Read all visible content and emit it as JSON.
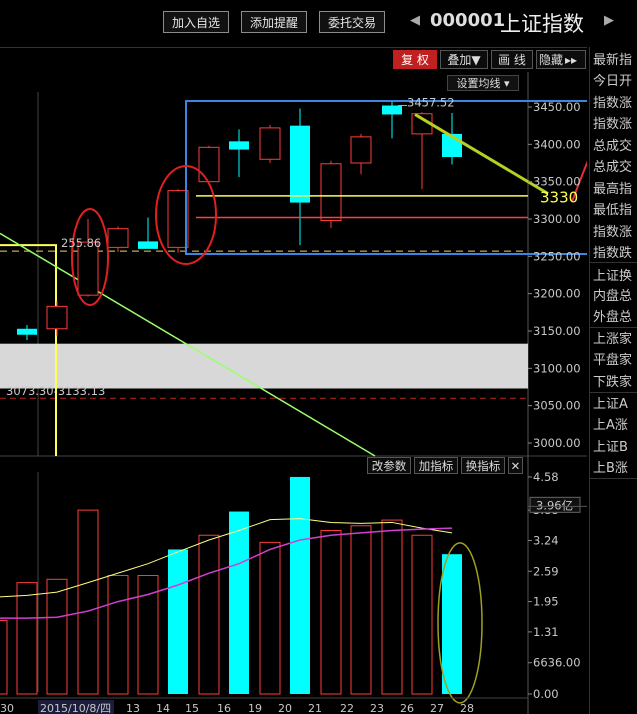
{
  "toolbar": {
    "add_watchlist": "加入自选",
    "add_alert": "添加提醒",
    "entrust_trade": "委托交易",
    "prev_arrow": "◀",
    "next_arrow": "▶",
    "stock_code": "000001",
    "stock_name": "上证指数"
  },
  "chart_toolbar": {
    "fuquan": "复 权",
    "overlay": "叠加▼",
    "draw": "画 线",
    "hide": "隐藏",
    "hide_arrows": "▸▸",
    "set_ma": "设置均线 ▾"
  },
  "right_panel": [
    "最新指",
    "今日开",
    "指数涨",
    "指数涨",
    "总成交",
    "总成交",
    "最高指",
    "最低指",
    "指数涨",
    "指数跌",
    "上证换",
    "内盘总",
    "外盘总",
    "上涨家",
    "平盘家",
    "下跌家",
    "上证A",
    "上A涨",
    "上证B",
    "上B涨"
  ],
  "price_axis": [
    "3450.00",
    "3400.00",
    "3350.00",
    "3300.00",
    "3250.00",
    "3200.00",
    "3150.00",
    "3100.00",
    "3050.00",
    "3000.00"
  ],
  "volume_axis": [
    "4.58",
    "3.88",
    "3.24",
    "2.59",
    "1.95",
    "1.31",
    "6636.00",
    "0.00"
  ],
  "volume_badge": "3.96亿",
  "annotations": {
    "high_label": "3457.52",
    "left_label": "255.86",
    "range_label": "3073.30-3133.13",
    "target_label": "3330"
  },
  "indicator_toolbar": {
    "change_param": "改参数",
    "add_indicator": "加指标",
    "switch_indicator": "换指标",
    "close": "✕"
  },
  "dates": [
    "30",
    "2015/10/8/四",
    "13",
    "14",
    "15",
    "16",
    "19",
    "20",
    "21",
    "22",
    "23",
    "26",
    "27",
    "28"
  ],
  "colors": {
    "up": "#ff3c3c",
    "down": "#00ffff",
    "yellow_line": "#ffff55",
    "green_line": "#9aff6a",
    "blue_box": "#3a86e0",
    "red_circle": "#e02020",
    "ma_purple": "#d040d0",
    "ma_yellow": "#ffff80"
  },
  "chart_data": {
    "type": "candlestick",
    "ylim": [
      2985,
      3470
    ],
    "candles": [
      {
        "o": 3145,
        "h": 3158,
        "l": 3138,
        "c": 3153,
        "up": false
      },
      {
        "o": 3153,
        "h": 3190,
        "l": 3143,
        "c": 3183,
        "up": true
      },
      {
        "o": 3198,
        "h": 3300,
        "l": 3196,
        "c": 3269,
        "up": true
      },
      {
        "o": 3262,
        "h": 3290,
        "l": 3256,
        "c": 3287,
        "up": true
      },
      {
        "o": 3270,
        "h": 3302,
        "l": 3261,
        "c": 3260,
        "up": false
      },
      {
        "o": 3262,
        "h": 3340,
        "l": 3255,
        "c": 3338,
        "up": true
      },
      {
        "o": 3350,
        "h": 3398,
        "l": 3345,
        "c": 3396,
        "up": true
      },
      {
        "o": 3404,
        "h": 3420,
        "l": 3356,
        "c": 3393,
        "up": false
      },
      {
        "o": 3380,
        "h": 3426,
        "l": 3375,
        "c": 3422,
        "up": true
      },
      {
        "o": 3425,
        "h": 3448,
        "l": 3265,
        "c": 3322,
        "up": false
      },
      {
        "o": 3298,
        "h": 3378,
        "l": 3288,
        "c": 3374,
        "up": true
      },
      {
        "o": 3375,
        "h": 3414,
        "l": 3360,
        "c": 3410,
        "up": true
      },
      {
        "o": 3440,
        "h": 3457.52,
        "l": 3408,
        "c": 3452,
        "up": false
      },
      {
        "o": 3414,
        "h": 3443,
        "l": 3340,
        "c": 3441,
        "up": true
      },
      {
        "o": 3414,
        "h": 3442,
        "l": 3373,
        "c": 3383,
        "up": false
      }
    ],
    "volumes": [
      {
        "v": 2.35,
        "up": true
      },
      {
        "v": 2.42,
        "up": true
      },
      {
        "v": 3.88,
        "up": true
      },
      {
        "v": 2.5,
        "up": true
      },
      {
        "v": 2.5,
        "up": true
      },
      {
        "v": 3.05,
        "up": false
      },
      {
        "v": 3.35,
        "up": true
      },
      {
        "v": 3.85,
        "up": false
      },
      {
        "v": 3.2,
        "up": true
      },
      {
        "v": 4.58,
        "up": false
      },
      {
        "v": 3.45,
        "up": true
      },
      {
        "v": 3.55,
        "up": true
      },
      {
        "v": 3.67,
        "up": true
      },
      {
        "v": 3.35,
        "up": true
      },
      {
        "v": 2.95,
        "up": false
      }
    ],
    "vol_ylim": [
      0,
      4.6
    ]
  }
}
